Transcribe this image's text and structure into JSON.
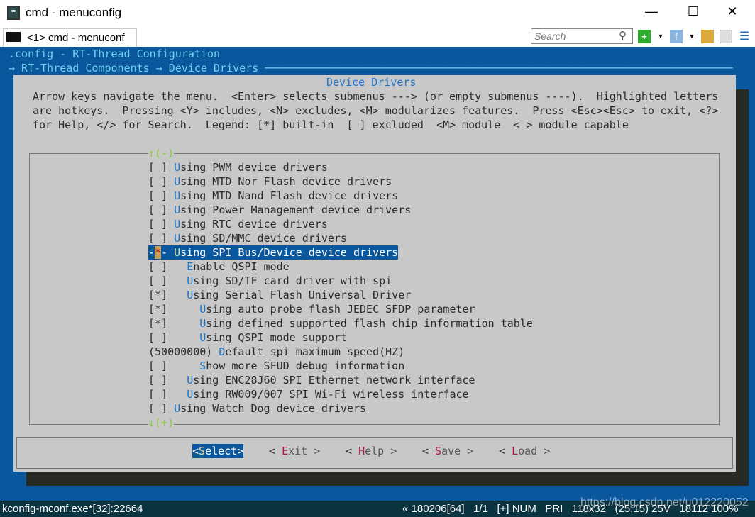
{
  "window": {
    "title": "cmd - menuconfig",
    "minimize": "—",
    "maximize": "☐",
    "close": "✕"
  },
  "tab": {
    "label": "<1> cmd - menuconf"
  },
  "toolbar": {
    "search_placeholder": "Search",
    "icons": [
      "search-icon",
      "new-console-icon",
      "dropdown-icon",
      "view-icon",
      "dropdown-icon",
      "lock-icon",
      "panel-icon",
      "menu-icon"
    ]
  },
  "terminal": {
    "config_title": ".config - RT-Thread Configuration",
    "breadcrumb": "→ RT-Thread Components → Device Drivers ─────────────────────────────────────────────────────────────────────────",
    "dialog_title": "Device Drivers",
    "help": [
      "Arrow keys navigate the menu.  <Enter> selects submenus ---> (or empty submenus ----).  Highlighted letters",
      "are hotkeys.  Pressing <Y> includes, <N> excludes, <M> modularizes features.  Press <Esc><Esc> to exit, <?>",
      "for Help, </> for Search.  Legend: [*] built-in  [ ] excluded  <M> module  < > module capable"
    ],
    "scroll_up": "↑(-)",
    "scroll_down": "↓(+)",
    "items": [
      {
        "prefix": "[ ] ",
        "hotkey": "U",
        "rest": "sing PWM device drivers"
      },
      {
        "prefix": "[ ] ",
        "hotkey": "U",
        "rest": "sing MTD Nor Flash device drivers"
      },
      {
        "prefix": "[ ] ",
        "hotkey": "U",
        "rest": "sing MTD Nand Flash device drivers"
      },
      {
        "prefix": "[ ] ",
        "hotkey": "U",
        "rest": "sing Power Management device drivers"
      },
      {
        "prefix": "[ ] ",
        "hotkey": "U",
        "rest": "sing RTC device drivers"
      },
      {
        "prefix": "[ ] ",
        "hotkey": "U",
        "rest": "sing SD/MMC device drivers"
      },
      {
        "prefix": "-*- ",
        "hotkey": "U",
        "rest": "sing SPI Bus/Device device drivers",
        "selected": true
      },
      {
        "prefix": "[ ]   ",
        "hotkey": "E",
        "rest": "nable QSPI mode"
      },
      {
        "prefix": "[ ]   ",
        "hotkey": "U",
        "rest": "sing SD/TF card driver with spi"
      },
      {
        "prefix": "[*]   ",
        "hotkey": "U",
        "rest": "sing Serial Flash Universal Driver"
      },
      {
        "prefix": "[*]     ",
        "hotkey": "U",
        "rest": "sing auto probe flash JEDEC SFDP parameter"
      },
      {
        "prefix": "[*]     ",
        "hotkey": "U",
        "rest": "sing defined supported flash chip information table"
      },
      {
        "prefix": "[ ]     ",
        "hotkey": "U",
        "rest": "sing QSPI mode support"
      },
      {
        "prefix": "(50000000) ",
        "hotkey": "D",
        "rest": "efault spi maximum speed(HZ)"
      },
      {
        "prefix": "[ ]     ",
        "hotkey": "S",
        "rest": "how more SFUD debug information"
      },
      {
        "prefix": "[ ]   ",
        "hotkey": "U",
        "rest": "sing ENC28J60 SPI Ethernet network interface"
      },
      {
        "prefix": "[ ]   ",
        "hotkey": "U",
        "rest": "sing RW009/007 SPI Wi-Fi wireless interface"
      },
      {
        "prefix": "[ ] ",
        "hotkey": "U",
        "rest": "sing Watch Dog device drivers"
      }
    ],
    "buttons": [
      {
        "l": "<",
        "h": "S",
        "r": "elect>",
        "selected": true
      },
      {
        "l": "< ",
        "h": "E",
        "r": "xit >"
      },
      {
        "l": "< ",
        "h": "H",
        "r": "elp >"
      },
      {
        "l": "< ",
        "h": "S",
        "r": "ave >"
      },
      {
        "l": "< ",
        "h": "L",
        "r": "oad >"
      }
    ]
  },
  "status": {
    "process": "kconfig-mconf.exe*[32]:22664",
    "info": "« 180206[64]   1/1   [+] NUM   PRI   118x32   (25,15) 25V   18112 100%",
    "watermark": "https://blog.csdn.net/u012220052"
  },
  "colors": {
    "terminal_bg": "#0a579d",
    "dialog_bg": "#c8c8c8",
    "hotkey": "#1d74c9",
    "selection": "#0a579d"
  }
}
